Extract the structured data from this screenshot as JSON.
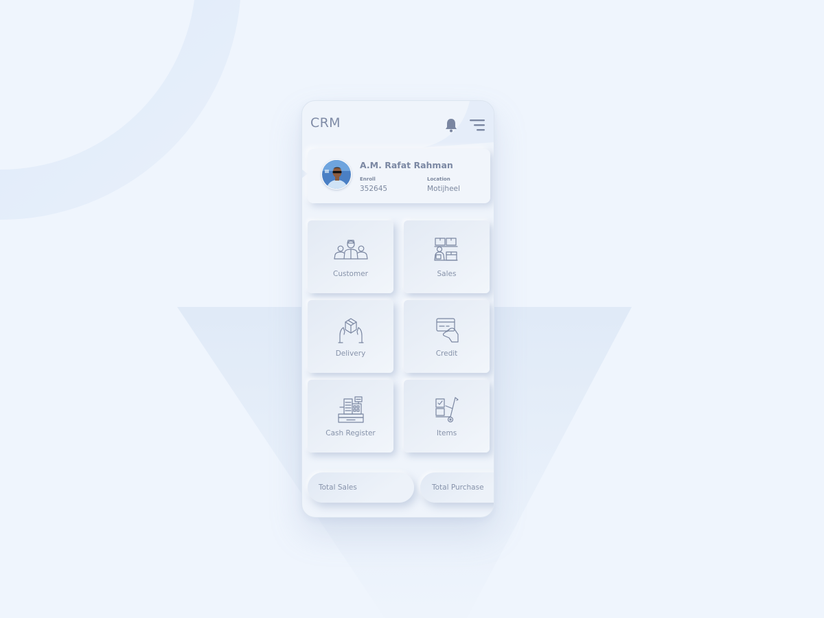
{
  "app": {
    "title": "CRM"
  },
  "header": {
    "notification_icon": "bell-icon",
    "menu_icon": "filter-menu-icon"
  },
  "profile": {
    "name": "A.M. Rafat Rahman",
    "enroll_label": "Enroll",
    "enroll_value": "352645",
    "location_label": "Location",
    "location_value": "Motijheel"
  },
  "menu_tiles": [
    {
      "label": "Customer",
      "icon": "customers-group-icon"
    },
    {
      "label": "Sales",
      "icon": "sales-boxes-icon"
    },
    {
      "label": "Delivery",
      "icon": "delivery-box-hands-icon"
    },
    {
      "label": "Credit",
      "icon": "credit-card-hand-icon"
    },
    {
      "label": "Cash Register",
      "icon": "cash-register-icon"
    },
    {
      "label": "Items",
      "icon": "hand-truck-icon"
    }
  ],
  "summary": {
    "total_sales_label": "Total Sales",
    "total_purchase_label": "Total Purchase"
  },
  "colors": {
    "background": "#eff5fd",
    "surface": "#eff4fb",
    "text": "#7f8ba6",
    "icon_stroke": "#7a86a1"
  }
}
